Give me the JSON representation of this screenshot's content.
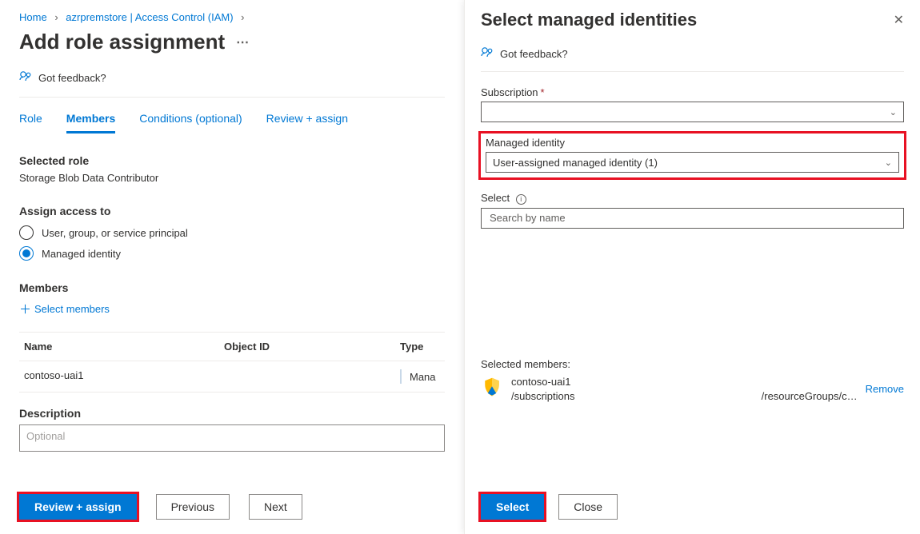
{
  "breadcrumb": {
    "home": "Home",
    "item2": "azrpremstore | Access Control (IAM)"
  },
  "page_title": "Add role assignment",
  "feedback": "Got feedback?",
  "tabs": {
    "role": "Role",
    "members": "Members",
    "conditions": "Conditions (optional)",
    "review": "Review + assign"
  },
  "selected_role": {
    "title": "Selected role",
    "value": "Storage Blob Data Contributor"
  },
  "assign_access": {
    "title": "Assign access to",
    "opt1": "User, group, or service principal",
    "opt2": "Managed identity"
  },
  "members": {
    "title": "Members",
    "add_link": "Select members",
    "col_name": "Name",
    "col_obj": "Object ID",
    "col_type": "Type",
    "row1_name": "contoso-uai1",
    "row1_type": "Mana"
  },
  "description": {
    "label": "Description",
    "placeholder": "Optional"
  },
  "buttons": {
    "review_assign": "Review + assign",
    "previous": "Previous",
    "next": "Next"
  },
  "right": {
    "title": "Select managed identities",
    "feedback": "Got feedback?",
    "subscription_label": "Subscription",
    "managed_identity_label": "Managed identity",
    "managed_identity_value": "User-assigned managed identity (1)",
    "select_label": "Select",
    "search_placeholder": "Search by name",
    "selected_members_label": "Selected members:",
    "member_name": "contoso-uai1",
    "member_path_left": "/subscriptions",
    "member_path_right": "/resourceGroups/c…",
    "remove": "Remove",
    "select_btn": "Select",
    "close_btn": "Close"
  }
}
